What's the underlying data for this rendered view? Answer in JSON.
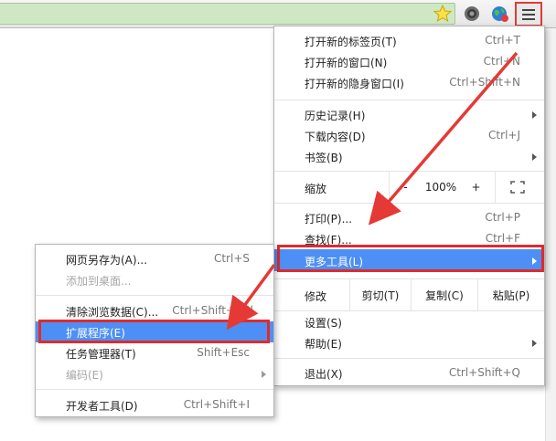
{
  "toolbar": {
    "icons": [
      "star-icon",
      "extension-gear-icon",
      "extension-globe-icon",
      "hamburger-menu-icon"
    ]
  },
  "main_menu": {
    "items": [
      {
        "label": "打开新的标签页(T)",
        "shortcut": "Ctrl+T"
      },
      {
        "label": "打开新的窗口(N)",
        "shortcut": "Ctrl+N"
      },
      {
        "label": "打开新的隐身窗口(I)",
        "shortcut": "Ctrl+Shift+N"
      },
      {
        "label": "历史记录(H)",
        "shortcut": ""
      },
      {
        "label": "下载内容(D)",
        "shortcut": "Ctrl+J"
      },
      {
        "label": "书签(B)",
        "shortcut": ""
      },
      {
        "label": "打印(P)...",
        "shortcut": "Ctrl+P"
      },
      {
        "label": "查找(F)...",
        "shortcut": "Ctrl+F"
      },
      {
        "label": "更多工具(L)",
        "shortcut": ""
      },
      {
        "label": "设置(S)",
        "shortcut": ""
      },
      {
        "label": "帮助(E)",
        "shortcut": ""
      },
      {
        "label": "退出(X)",
        "shortcut": "Ctrl+Shift+Q"
      }
    ],
    "zoom": {
      "label": "缩放",
      "minus": "-",
      "value": "100%",
      "plus": "+"
    },
    "edit": {
      "label": "修改",
      "cut": "剪切(T)",
      "copy": "复制(C)",
      "paste": "粘贴(P)"
    }
  },
  "sub_menu": {
    "items": [
      {
        "label": "网页另存为(A)...",
        "shortcut": "Ctrl+S"
      },
      {
        "label": "添加到桌面...",
        "shortcut": ""
      },
      {
        "label": "清除浏览数据(C)...",
        "shortcut": "Ctrl+Shift+Del"
      },
      {
        "label": "扩展程序(E)",
        "shortcut": ""
      },
      {
        "label": "任务管理器(T)",
        "shortcut": "Shift+Esc"
      },
      {
        "label": "编码(E)",
        "shortcut": ""
      },
      {
        "label": "开发者工具(D)",
        "shortcut": "Ctrl+Shift+I"
      }
    ]
  },
  "colors": {
    "highlight": "#4d8ff4",
    "annotation_red": "#e02b2b",
    "omnibox_green": "#cfe8c4"
  }
}
